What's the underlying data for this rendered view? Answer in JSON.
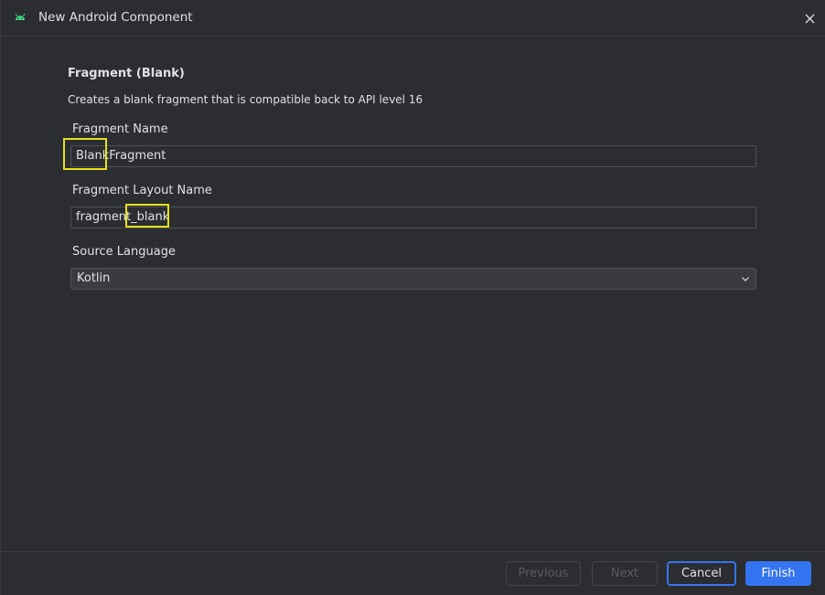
{
  "window": {
    "title": "New Android Component"
  },
  "header": {
    "section_title": "Fragment (Blank)",
    "description": "Creates a blank fragment that is compatible back to API level 16"
  },
  "fields": {
    "fragment_name": {
      "label": "Fragment Name",
      "value": "BlankFragment"
    },
    "layout_name": {
      "label": "Fragment Layout Name",
      "value": "fragment_blank"
    },
    "source_language": {
      "label": "Source Language",
      "value": "Kotlin"
    }
  },
  "footer": {
    "previous_label": "Previous",
    "next_label": "Next",
    "cancel_label": "Cancel",
    "finish_label": "Finish"
  },
  "colors": {
    "background": "#2b2d30",
    "accent": "#3574f0",
    "highlight": "#e8e01a",
    "android_green": "#3ddc84"
  }
}
